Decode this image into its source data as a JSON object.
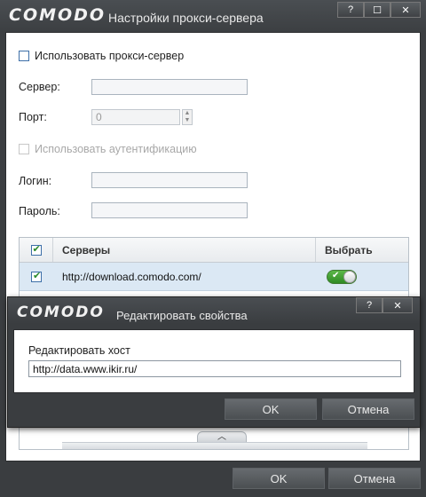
{
  "main": {
    "brand": "COMODO",
    "title": "Настройки прокси-сервера",
    "title_buttons": [
      "?",
      "☐",
      "✕"
    ],
    "use_proxy_label": "Использовать прокси-сервер",
    "server_label": "Сервер:",
    "server_value": "",
    "port_label": "Порт:",
    "port_value": "0",
    "use_auth_label": "Использовать аутентификацию",
    "login_label": "Логин:",
    "login_value": "",
    "password_label": "Пароль:",
    "password_value": "",
    "table": {
      "headers": [
        "",
        "Серверы",
        "Выбрать"
      ],
      "rows": [
        {
          "checked": true,
          "server": "http://download.comodo.com/",
          "selected": true
        }
      ]
    },
    "ok_label": "OK",
    "cancel_label": "Отмена"
  },
  "dialog": {
    "brand": "COMODO",
    "title": "Редактировать свойства",
    "title_buttons": [
      "?",
      "✕"
    ],
    "host_label": "Редактировать хост",
    "host_value": "http://data.www.ikir.ru/",
    "ok_label": "OK",
    "cancel_label": "Отмена"
  },
  "colors": {
    "chrome": "#3c3f42",
    "selected_row": "#dbe8f4",
    "toggle_on": "#3e9a30"
  }
}
